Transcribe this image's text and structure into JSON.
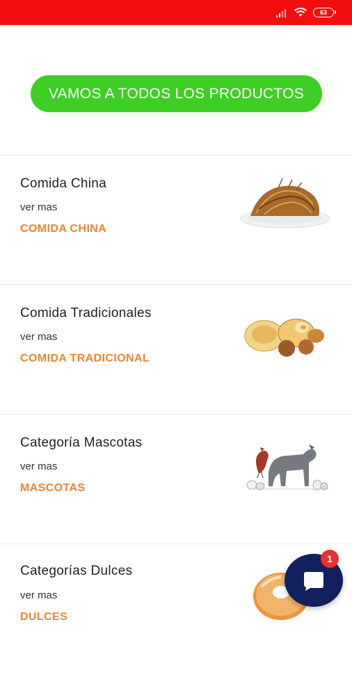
{
  "status_bar": {
    "battery_level": "63",
    "background_color": "#f20f0f",
    "icons": [
      "signal-icon",
      "wifi-icon",
      "battery-icon"
    ]
  },
  "cta": {
    "label": "VAMOS A TODOS LOS PRODUCTOS",
    "color": "#3fce25"
  },
  "categories": [
    {
      "title": "Comida China",
      "more": "ver mas",
      "link": "COMIDA CHINA",
      "image": "fried-noodles-plate"
    },
    {
      "title": "Comida Tradicionales",
      "more": "ver mas",
      "link": "COMIDA TRADICIONAL",
      "image": "traditional-food-platter"
    },
    {
      "title": "Categoría Mascotas",
      "more": "ver mas",
      "link": "MASCOTAS",
      "image": "pets-group"
    },
    {
      "title": "Categorías Dulces",
      "more": "ver mas",
      "link": "DULCES",
      "image": "glazed-donut"
    }
  ],
  "chat": {
    "badge_count": "1",
    "icon": "chat-bubble-icon",
    "color": "#12205e"
  },
  "accent_color": "#ee8430"
}
